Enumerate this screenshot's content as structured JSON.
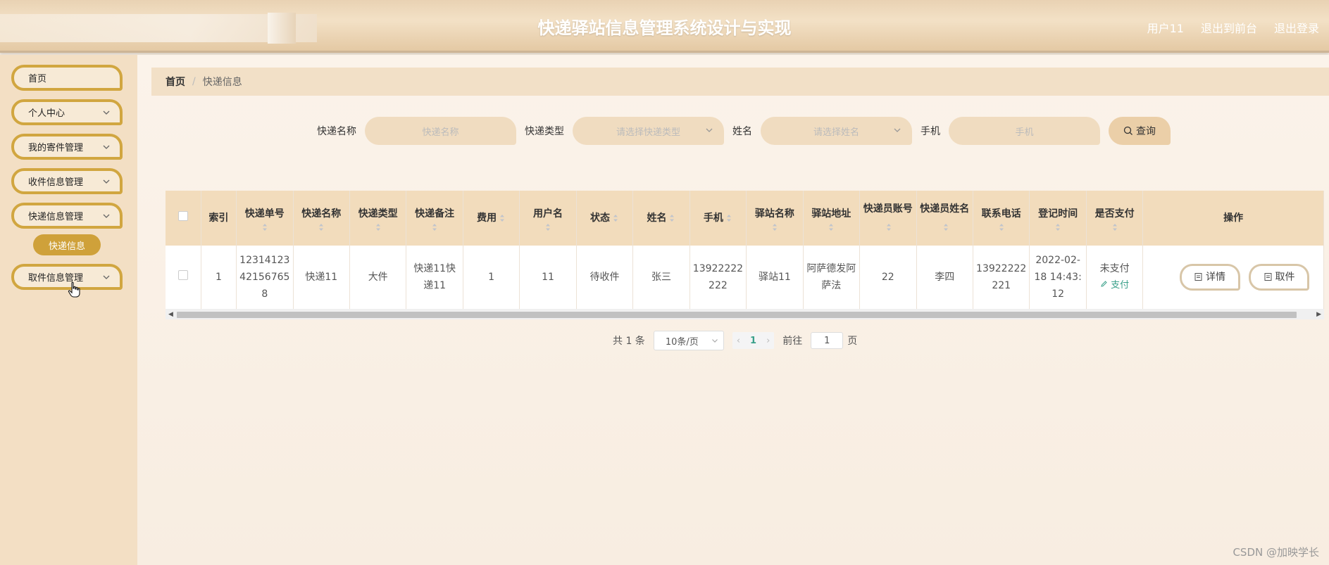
{
  "header": {
    "title": "快递驿站信息管理系统设计与实现",
    "user": "用户11",
    "back_to_front": "退出到前台",
    "logout": "退出登录"
  },
  "sidebar": {
    "items": [
      {
        "label": "首页",
        "has_arrow": false
      },
      {
        "label": "个人中心",
        "has_arrow": true
      },
      {
        "label": "我的寄件管理",
        "has_arrow": true
      },
      {
        "label": "收件信息管理",
        "has_arrow": true
      },
      {
        "label": "快递信息管理",
        "has_arrow": true
      },
      {
        "label": "取件信息管理",
        "has_arrow": true
      }
    ],
    "active_sub": "快递信息"
  },
  "breadcrumb": {
    "home": "首页",
    "current": "快递信息"
  },
  "search": {
    "name_label": "快递名称",
    "name_placeholder": "快递名称",
    "type_label": "快递类型",
    "type_placeholder": "请选择快递类型",
    "person_label": "姓名",
    "person_placeholder": "请选择姓名",
    "phone_label": "手机",
    "phone_placeholder": "手机",
    "button": "查询"
  },
  "table": {
    "headers": [
      "索引",
      "快递单号",
      "快递名称",
      "快递类型",
      "快递备注",
      "费用",
      "用户名",
      "状态",
      "姓名",
      "手机",
      "驿站名称",
      "驿站地址",
      "快递员账号",
      "快递员姓名",
      "联系电话",
      "登记时间",
      "是否支付",
      "操作"
    ],
    "rows": [
      {
        "index": "1",
        "tracking": "12314123421567658",
        "name": "快递11",
        "type": "大件",
        "remark": "快递11快递11",
        "fee": "1",
        "username": "11",
        "status": "待收件",
        "person": "张三",
        "phone": "13922222222",
        "station": "驿站11",
        "address": "阿萨德发阿萨法",
        "courier_account": "22",
        "courier_name": "李四",
        "contact": "13922222221",
        "reg_time": "2022-02-18 14:43:12",
        "paid": "未支付",
        "pay_action": "支付",
        "detail_btn": "详情",
        "pickup_btn": "取件"
      }
    ]
  },
  "pager": {
    "total": "共 1 条",
    "page_size": "10条/页",
    "current": "1",
    "goto_label": "前往",
    "goto_value": "1",
    "page_suffix": "页"
  },
  "watermark": "CSDN @加映学长"
}
